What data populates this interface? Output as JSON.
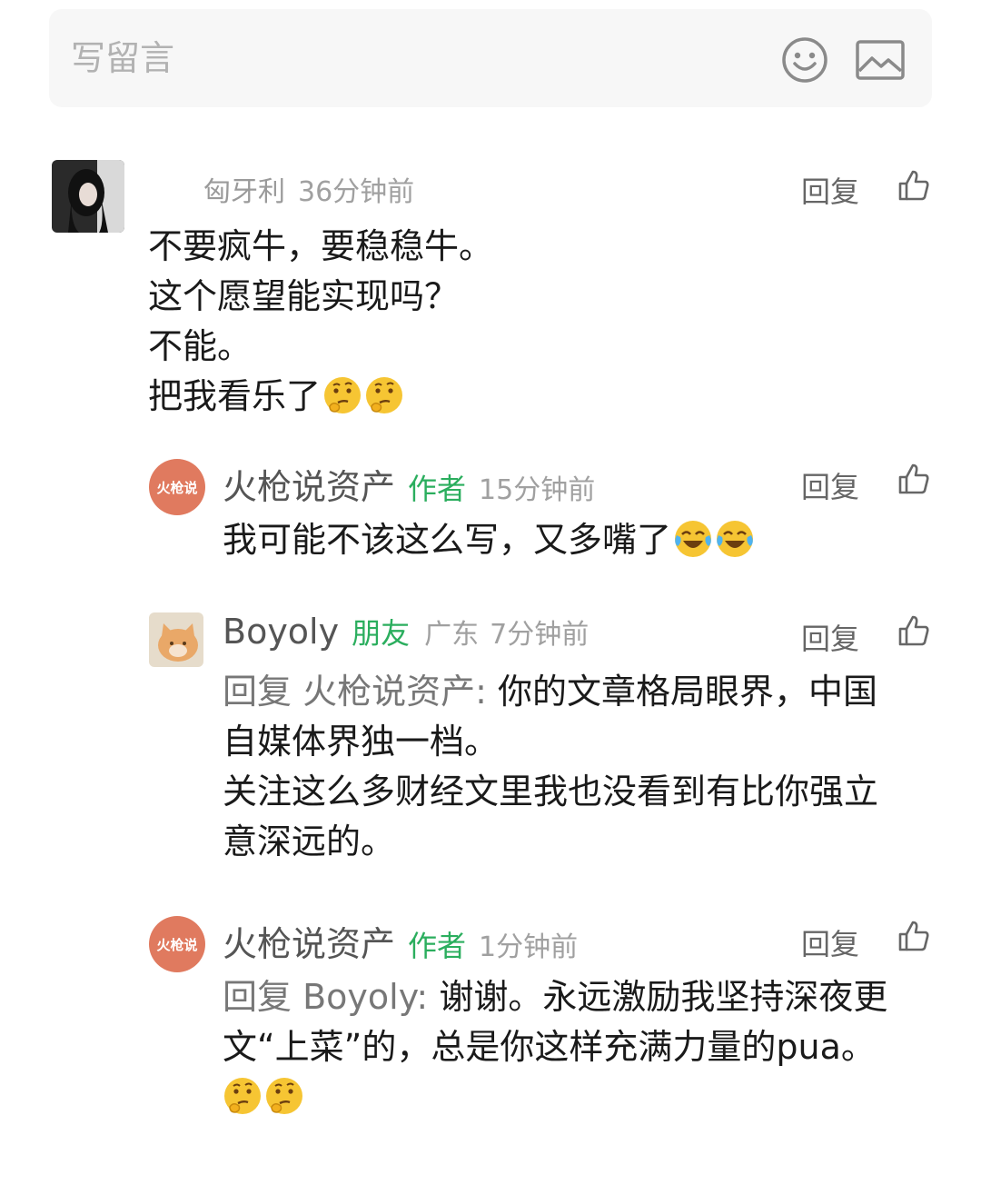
{
  "compose": {
    "placeholder": "写留言",
    "emoji_icon": "emoji-icon",
    "image_icon": "image-icon"
  },
  "comments": [
    {
      "username": "匈牙利",
      "time": "36分钟前",
      "reply_label": "回复",
      "lines": [
        "不要疯牛，要稳稳牛。",
        "这个愿望能实现吗？",
        "不能。",
        "把我看乐了"
      ],
      "emojis": [
        "thinking-face",
        "thinking-face"
      ]
    },
    {
      "username": "火枪说资产",
      "avatar_text": "火枪说",
      "role": "作者",
      "time": "15分钟前",
      "reply_label": "回复",
      "text": "我可能不该这么写，又多嘴了",
      "emojis": [
        "laughing-crying-face",
        "laughing-crying-face"
      ]
    },
    {
      "username": "Boyoly",
      "role": "朋友",
      "location": "广东",
      "time": "7分钟前",
      "reply_label": "回复",
      "quote_prefix": "回复 火枪说资产:",
      "lines": [
        " 你的文章格局眼界，中国",
        "自媒体界独一档。",
        "关注这么多财经文里我也没看到有比你强立",
        "意深远的。"
      ]
    },
    {
      "username": "火枪说资产",
      "avatar_text": "火枪说",
      "role": "作者",
      "time": "1分钟前",
      "reply_label": "回复",
      "quote_prefix": "回复 Boyoly:",
      "lines": [
        " 谢谢。永远激励我坚持深夜更",
        "文“上菜”的，总是你这样充满力量的pua。"
      ],
      "emojis": [
        "thinking-face",
        "thinking-face"
      ]
    }
  ],
  "colors": {
    "role_green": "#2bae5e",
    "brand_avatar": "#e07a5f",
    "compose_bg": "#f7f7f7"
  }
}
